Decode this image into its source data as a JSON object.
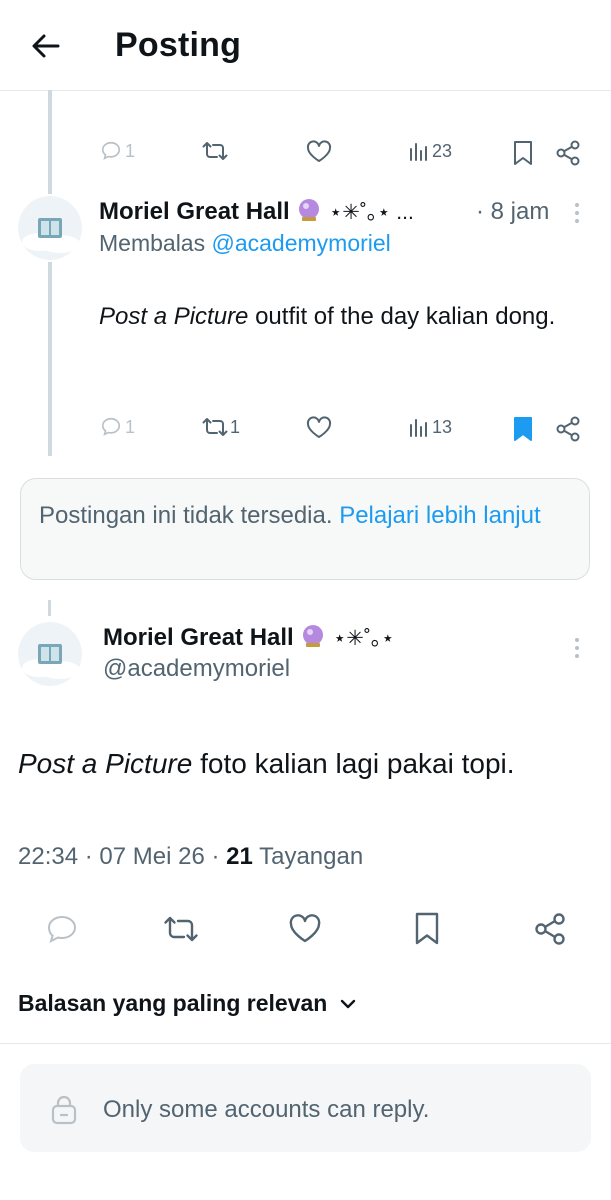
{
  "header": {
    "title": "Posting"
  },
  "reply_prev": {
    "stats": {
      "replies": "1",
      "retweets": "",
      "views": "23"
    }
  },
  "reply_tweet": {
    "author_name": "Moriel Great Hall",
    "author_decor": "⋆✳︎˚｡⋆ ...",
    "time": "· 8 jam",
    "replying_to_label": "Membalas",
    "replying_to_handle": "@academymoriel",
    "body_italic": "Post a Picture",
    "body_rest": " outfit of the day kalian dong.",
    "stats": {
      "replies": "1",
      "retweets": "1",
      "views": "13"
    }
  },
  "notice": {
    "text": "Postingan ini tidak tersedia.",
    "link": "Pelajari lebih lanjut"
  },
  "main_tweet": {
    "author_name": "Moriel Great Hall",
    "author_decor": "⋆✳︎˚｡⋆",
    "handle": "@academymoriel",
    "body_italic": "Post a Picture",
    "body_rest": " foto kalian lagi pakai topi.",
    "time": "22:34",
    "date": "07 Mei 26",
    "views_count": "21",
    "views_label": "Tayangan",
    "sep": "·"
  },
  "replies_sort": {
    "label": "Balasan yang paling relevan"
  },
  "reply_restriction": {
    "text": "Only some accounts can reply."
  },
  "colors": {
    "accent": "#1d9bf0",
    "muted": "#536471",
    "bookmark_active": "#1d9bf0"
  }
}
